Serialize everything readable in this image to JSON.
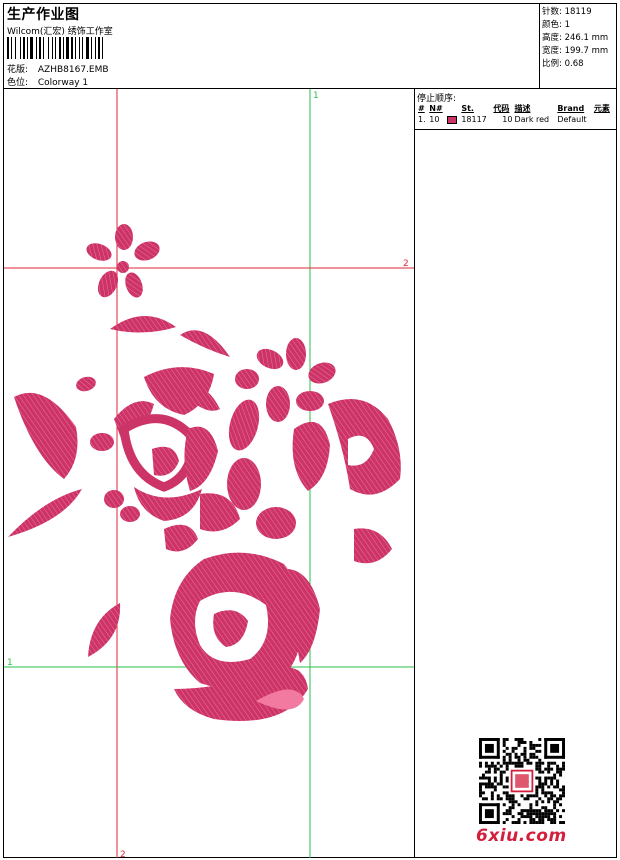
{
  "header": {
    "title": "生产作业图",
    "subtitle": "Wilcom(汇宏) 绣饰工作室",
    "design_label": "花版:",
    "design_value": "AZHB8167.EMB",
    "colorway_label": "色位:",
    "colorway_value": "Colorway 1"
  },
  "specs": [
    {
      "label": "针数:",
      "value": "18119"
    },
    {
      "label": "颜色:",
      "value": "1"
    },
    {
      "label": "高度:",
      "value": "246.1 mm"
    },
    {
      "label": "宽度:",
      "value": "199.7 mm"
    },
    {
      "label": "比例:",
      "value": "0.68"
    }
  ],
  "guides": {
    "vertical_red_label": "2",
    "vertical_green_label": "1",
    "horizontal_red_label": "2",
    "horizontal_green_label": "1"
  },
  "stop_sequence": {
    "title": "停止顺序:",
    "headers": [
      "#",
      "N#",
      "St.",
      "代码",
      "描述",
      "Brand",
      "元素"
    ],
    "rows": [
      {
        "num": "1.",
        "needle": "10",
        "stitches": "18117",
        "code": "10",
        "desc": "Dark red",
        "brand": "Default",
        "color": "#cc3366"
      }
    ]
  },
  "colors": {
    "thread": "#cc3366",
    "guide_red": "#e0263a",
    "guide_green": "#29c24a",
    "logo": "#d41f3c"
  },
  "logo_text": "6xiu.com"
}
